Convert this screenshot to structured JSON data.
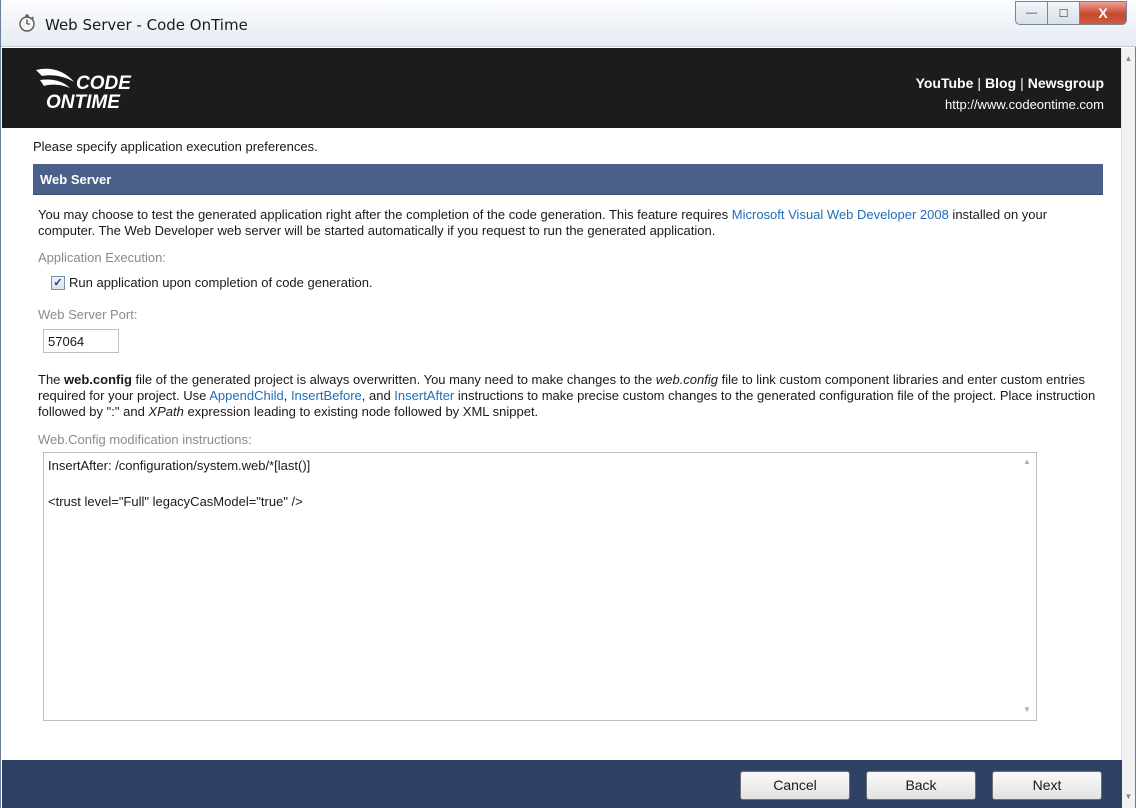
{
  "window": {
    "title": "Web Server - Code OnTime",
    "minimize_glyph": "—",
    "maximize_glyph": "☐",
    "close_glyph": "X"
  },
  "banner": {
    "logo_line1": "CODE",
    "logo_line2": "ONTIME",
    "links": [
      "YouTube",
      "Blog",
      "Newsgroup"
    ],
    "separator": "|",
    "url": "http://www.codeontime.com",
    "background": "#1c1c1c"
  },
  "intro_text": "Please specify application execution preferences.",
  "section": {
    "title": "Web Server",
    "background": "#4a6088"
  },
  "description": {
    "part1": "You may choose to test the generated application right after the completion of the code generation. This feature requires ",
    "link": "Microsoft Visual Web Developer 2008",
    "part2": " installed on your computer. The Web Developer web server will be started automatically if you request to run the generated application."
  },
  "application_execution": {
    "label": "Application Execution:",
    "checkbox_label": "Run application upon completion of code generation.",
    "checked": true
  },
  "port": {
    "label": "Web Server Port:",
    "value": "57064"
  },
  "webconfig": {
    "t1": "The ",
    "bold": "web.config",
    "t2": " file of the generated project is always overwritten. You many need to make changes to the ",
    "italic1": "web.config",
    "t3": " file to link custom component libraries and enter custom entries required for your project. Use ",
    "link1": "AppendChild",
    "t4": ", ",
    "link2": "InsertBefore",
    "t5": ", and ",
    "link3": "InsertAfter",
    "t6": " instructions to make precise custom changes to the generated configuration file of the project. Place instruction followed by \":\" and ",
    "italic2": "XPath",
    "t7": " expression leading to existing node followed by XML snippet.",
    "label": "Web.Config modification instructions:",
    "content": "InsertAfter: /configuration/system.web/*[last()]\n\n<trust level=\"Full\" legacyCasModel=\"true\" />"
  },
  "footer": {
    "cancel": "Cancel",
    "back": "Back",
    "next": "Next",
    "background": "#2f4266"
  }
}
